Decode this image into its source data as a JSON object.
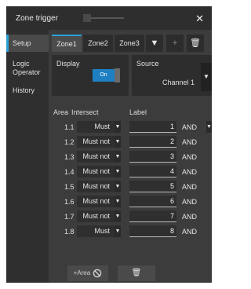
{
  "window": {
    "title": "Zone trigger",
    "close_symbol": "✕"
  },
  "sidebar": {
    "items": [
      {
        "label": "Setup",
        "active": true
      },
      {
        "label": "Logic Operator",
        "active": false
      },
      {
        "label": "History",
        "active": false
      }
    ]
  },
  "tabs": {
    "items": [
      {
        "label": "Zone1",
        "active": true
      },
      {
        "label": "Zone2",
        "active": false
      },
      {
        "label": "Zone3",
        "active": false
      }
    ],
    "dropdown_symbol": "▼",
    "add_symbol": "+",
    "delete_symbol": "🗑"
  },
  "display": {
    "label": "Display",
    "toggle_text": "On"
  },
  "source": {
    "label": "Source",
    "value": "Channel 1",
    "arrow": "▼"
  },
  "table": {
    "headers": {
      "area": "Area",
      "intersect": "Intersect",
      "label": "Label"
    },
    "arrow": "▼",
    "rows": [
      {
        "num": "1.1",
        "intersect": "Must",
        "label": "1",
        "logic": "AND",
        "has_logic_dropdown": true
      },
      {
        "num": "1.2",
        "intersect": "Must not",
        "label": "2",
        "logic": "AND",
        "has_logic_dropdown": false
      },
      {
        "num": "1.3",
        "intersect": "Must not",
        "label": "3",
        "logic": "AND",
        "has_logic_dropdown": false
      },
      {
        "num": "1.4",
        "intersect": "Must not",
        "label": "4",
        "logic": "AND",
        "has_logic_dropdown": false
      },
      {
        "num": "1.5",
        "intersect": "Must not",
        "label": "5",
        "logic": "AND",
        "has_logic_dropdown": false
      },
      {
        "num": "1.6",
        "intersect": "Must not",
        "label": "6",
        "logic": "AND",
        "has_logic_dropdown": false
      },
      {
        "num": "1.7",
        "intersect": "Must not",
        "label": "7",
        "logic": "AND",
        "has_logic_dropdown": false
      },
      {
        "num": "1.8",
        "intersect": "Must",
        "label": "8",
        "logic": "AND",
        "has_logic_dropdown": false
      }
    ]
  },
  "bottom": {
    "add_area_label": "+Area",
    "delete_symbol": "🗑"
  },
  "colors": {
    "accent": "#2aa0d8",
    "toggle_on": "#1e7fc2",
    "panel": "#3c3c3c",
    "titlebar": "#2e2e2e"
  }
}
